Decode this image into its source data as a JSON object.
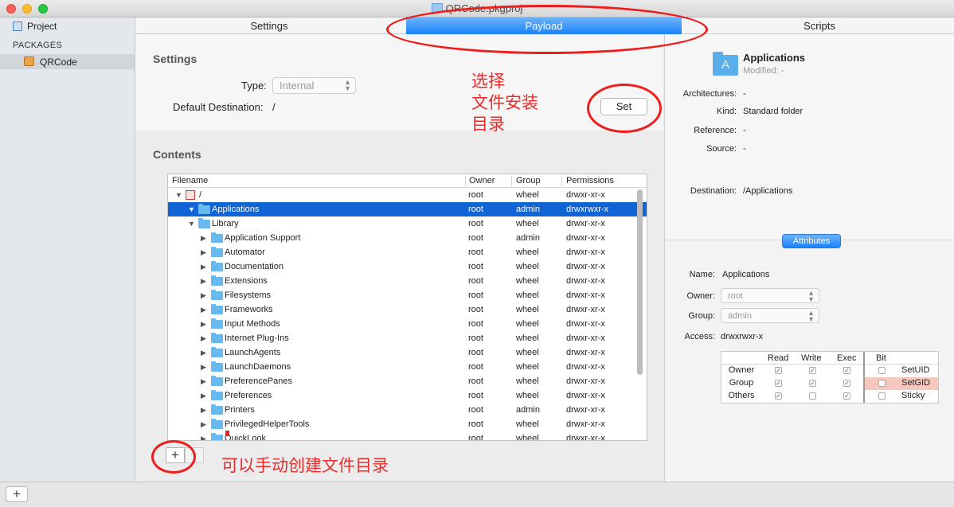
{
  "window": {
    "title": "QRCode.pkgproj"
  },
  "sidebar": {
    "project_label": "Project",
    "section_label": "PACKAGES",
    "package_label": "QRCode"
  },
  "tabs": [
    {
      "label": "Settings"
    },
    {
      "label": "Payload",
      "selected": true
    },
    {
      "label": "Scripts"
    }
  ],
  "settings": {
    "heading": "Settings",
    "type_label": "Type:",
    "type_value": "Internal",
    "dest_label": "Default Destination:",
    "dest_value": "/",
    "set_button": "Set"
  },
  "contents": {
    "heading": "Contents",
    "columns": [
      "Filename",
      "Owner",
      "Group",
      "Permissions"
    ],
    "rows": [
      {
        "name": "/",
        "owner": "root",
        "group": "wheel",
        "perms": "drwxr-xr-x",
        "level": 0,
        "icon": "root",
        "expanded": true
      },
      {
        "name": "Applications",
        "owner": "root",
        "group": "admin",
        "perms": "drwxrwxr-x",
        "level": 1,
        "icon": "folder",
        "expanded": true,
        "selected": true
      },
      {
        "name": "Library",
        "owner": "root",
        "group": "wheel",
        "perms": "drwxr-xr-x",
        "level": 1,
        "icon": "folder",
        "expanded": true
      },
      {
        "name": "Application Support",
        "owner": "root",
        "group": "admin",
        "perms": "drwxr-xr-x",
        "level": 2,
        "icon": "folder",
        "expanded": false
      },
      {
        "name": "Automator",
        "owner": "root",
        "group": "wheel",
        "perms": "drwxr-xr-x",
        "level": 2,
        "icon": "folder",
        "expanded": false
      },
      {
        "name": "Documentation",
        "owner": "root",
        "group": "wheel",
        "perms": "drwxr-xr-x",
        "level": 2,
        "icon": "folder",
        "expanded": false
      },
      {
        "name": "Extensions",
        "owner": "root",
        "group": "wheel",
        "perms": "drwxr-xr-x",
        "level": 2,
        "icon": "folder",
        "expanded": false
      },
      {
        "name": "Filesystems",
        "owner": "root",
        "group": "wheel",
        "perms": "drwxr-xr-x",
        "level": 2,
        "icon": "folder",
        "expanded": false
      },
      {
        "name": "Frameworks",
        "owner": "root",
        "group": "wheel",
        "perms": "drwxr-xr-x",
        "level": 2,
        "icon": "folder",
        "expanded": false
      },
      {
        "name": "Input Methods",
        "owner": "root",
        "group": "wheel",
        "perms": "drwxr-xr-x",
        "level": 2,
        "icon": "folder",
        "expanded": false
      },
      {
        "name": "Internet Plug-Ins",
        "owner": "root",
        "group": "wheel",
        "perms": "drwxr-xr-x",
        "level": 2,
        "icon": "folder",
        "expanded": false
      },
      {
        "name": "LaunchAgents",
        "owner": "root",
        "group": "wheel",
        "perms": "drwxr-xr-x",
        "level": 2,
        "icon": "folder",
        "expanded": false
      },
      {
        "name": "LaunchDaemons",
        "owner": "root",
        "group": "wheel",
        "perms": "drwxr-xr-x",
        "level": 2,
        "icon": "folder",
        "expanded": false
      },
      {
        "name": "PreferencePanes",
        "owner": "root",
        "group": "wheel",
        "perms": "drwxr-xr-x",
        "level": 2,
        "icon": "folder",
        "expanded": false
      },
      {
        "name": "Preferences",
        "owner": "root",
        "group": "wheel",
        "perms": "drwxr-xr-x",
        "level": 2,
        "icon": "folder",
        "expanded": false
      },
      {
        "name": "Printers",
        "owner": "root",
        "group": "admin",
        "perms": "drwxr-xr-x",
        "level": 2,
        "icon": "folder",
        "expanded": false
      },
      {
        "name": "PrivilegedHelperTools",
        "owner": "root",
        "group": "wheel",
        "perms": "drwxr-xr-x",
        "level": 2,
        "icon": "folder",
        "expanded": false
      },
      {
        "name": "QuickLook",
        "owner": "root",
        "group": "wheel",
        "perms": "drwxr-xr-x",
        "level": 2,
        "icon": "folder",
        "expanded": false
      }
    ],
    "add_button": "+",
    "remove_button": "−"
  },
  "inspector": {
    "name": "Applications",
    "modified_label": "Modified:",
    "modified_value": "-",
    "architectures_label": "Architectures:",
    "architectures_value": "-",
    "kind_label": "Kind:",
    "kind_value": "Standard folder",
    "reference_label": "Reference:",
    "reference_value": "-",
    "source_label": "Source:",
    "source_value": "-",
    "destination_label": "Destination:",
    "destination_value": "/Applications",
    "attributes_button": "Attributes",
    "attr_name_label": "Name:",
    "attr_name_value": "Applications",
    "owner_label": "Owner:",
    "owner_value": "root",
    "group_label": "Group:",
    "group_value": "admin",
    "access_label": "Access:",
    "access_value": "drwxrwxr-x",
    "perm_columns": [
      "Read",
      "Write",
      "Exec"
    ],
    "bit_column": "Bit",
    "perm_rows": [
      {
        "label": "Owner",
        "read": true,
        "write": true,
        "exec": true,
        "bit_label": "SetUID",
        "bit": false
      },
      {
        "label": "Group",
        "read": true,
        "write": true,
        "exec": true,
        "bit_label": "SetGID",
        "bit": false
      },
      {
        "label": "Others",
        "read": true,
        "write": false,
        "exec": true,
        "bit_label": "Sticky",
        "bit": false
      }
    ]
  },
  "annotations": {
    "text1": "选择",
    "text2": "文件安装",
    "text3": "目录",
    "text4": "可以手动创建文件目录"
  },
  "bottom": {
    "add_button": "+"
  },
  "colors": {
    "accent": "#1a82fb",
    "selection": "#1064d6",
    "annotation": "#ee1c1c"
  }
}
